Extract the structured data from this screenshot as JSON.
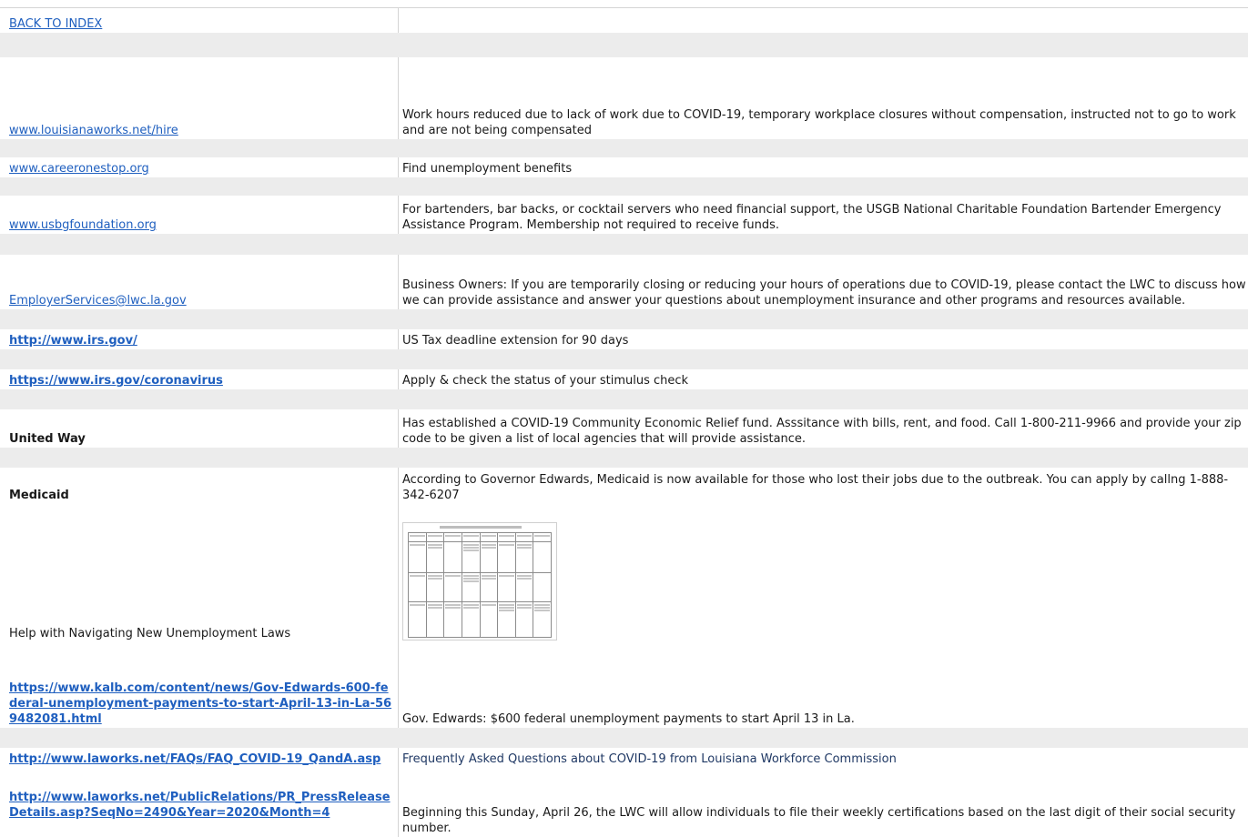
{
  "rows": {
    "back": {
      "label": "BACK TO INDEX "
    },
    "r1": {
      "link": "www.louisianaworks.net/hire ",
      "desc": "Work hours reduced due to lack of work due to COVID-19, temporary workplace closures without compensation, instructed not to go to work and are not being compensated"
    },
    "r2": {
      "link": "www.careeronestop.org",
      "desc": "Find unemployment benefits"
    },
    "r3": {
      "link": "www.usbgfoundation.org",
      "desc": "For bartenders, bar backs, or cocktail servers who need financial support, the USGB National Charitable Foundation Bartender Emergency Assistance Program.  Membership not required to receive funds."
    },
    "r4": {
      "link": "EmployerServices@lwc.la.gov",
      "desc": "Business Owners:  If you are temporarily closing or reducing your hours of operations due to COVID-19, please contact the LWC to discuss how we can provide assistance and answer your questions about unemployment insurance and other programs and resources available."
    },
    "r5": {
      "link": "http://www.irs.gov/",
      "desc": "US Tax deadline extension for 90 days"
    },
    "r6": {
      "link": "https://www.irs.gov/coronavirus",
      "desc": "Apply & check the status of your stimulus check"
    },
    "r7": {
      "label": "United Way",
      "desc": "Has established a COVID-19 Community Economic Relief fund.  Asssitance with bills, rent, and food.  Call 1-800-211-9966 and provide your zip code to be given a list of local agencies that will provide assistance."
    },
    "r8": {
      "label": "Medicaid",
      "desc": "According to Governor Edwards, Medicaid is now available for those who lost their jobs due to the outbreak.  You can apply by callng 1-888-342-6207"
    },
    "r9": {
      "label": "Help with Navigating New Unemployment Laws"
    },
    "r10": {
      "link": "https://www.kalb.com/content/news/Gov-Edwards-600-federal-unemployment-payments-to-start-April-13-in-La-569482081.html",
      "desc": "Gov. Edwards: $600 federal unemployment payments to start April 13 in La."
    },
    "r11": {
      "link": "http://www.laworks.net/FAQs/FAQ_COVID-19_QandA.asp",
      "desc": "Frequently Asked Questions about COVID-19 from Louisiana Workforce Commission"
    },
    "r12": {
      "link": "http://www.laworks.net/PublicRelations/PR_PressReleaseDetails.asp?SeqNo=2490&Year=2020&Month=4",
      "desc": "Beginning this Sunday, April 26, the LWC will allow individuals to file their weekly certifications based on the last digit of their social security number."
    }
  },
  "colors": {
    "link": "#1f5fbf",
    "band": "#ececec",
    "grid": "#d4d4d4",
    "navy_text": "#1f3864"
  },
  "icons": {
    "embedded_table": "spreadsheet-thumbnail"
  }
}
